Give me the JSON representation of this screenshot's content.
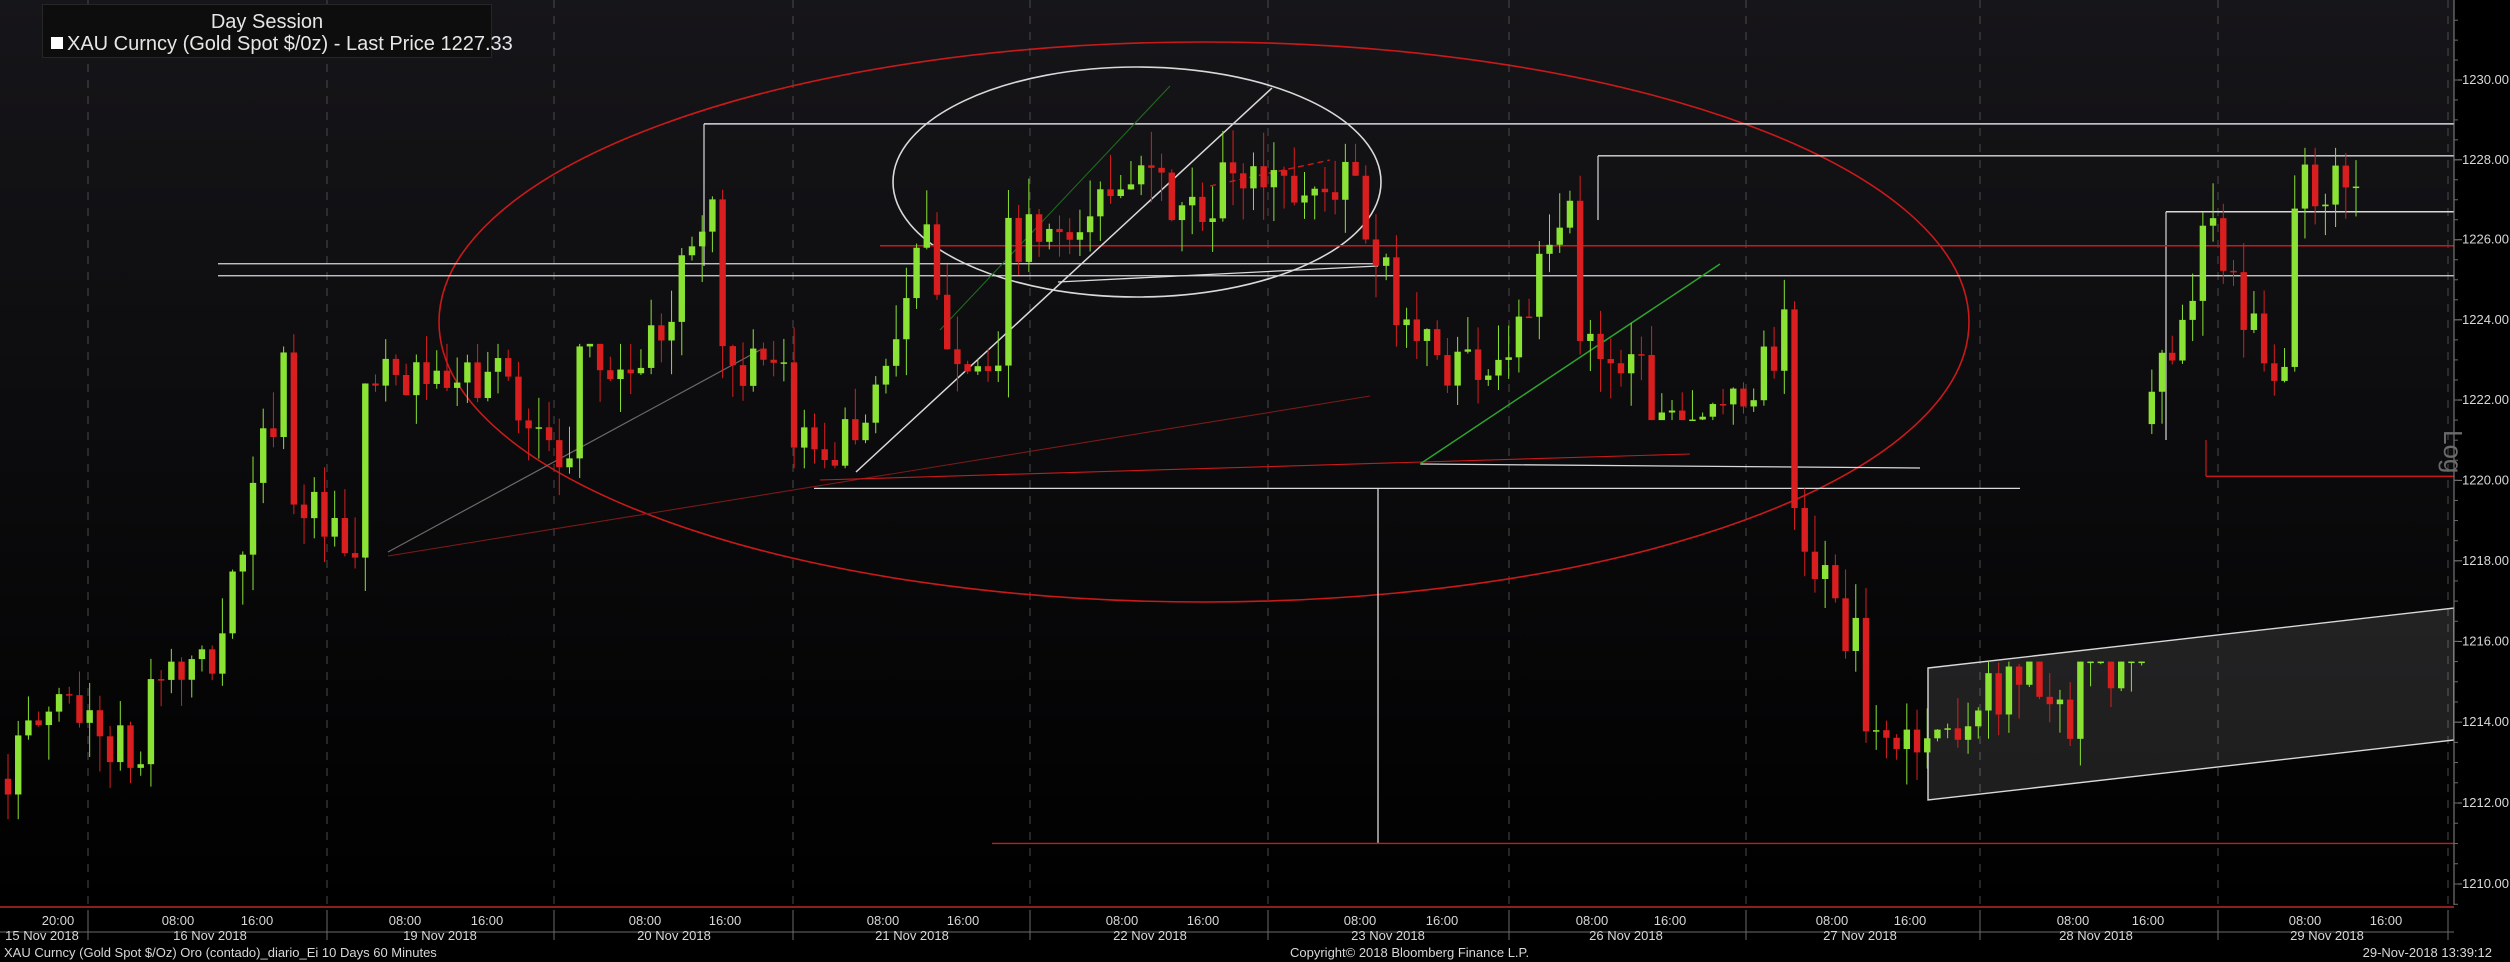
{
  "legend": {
    "title": "Day Session",
    "series_label": "XAU Curncy (Gold Spot $/0z) - Last Price 1227.33"
  },
  "footer": {
    "left": "XAU Curncy (Gold Spot  $/Oz) Oro (contado)_diario_Ei 10 Days 60 Minutes",
    "center": "Copyright© 2018 Bloomberg Finance L.P.",
    "right": "29-Nov-2018 13:39:12"
  },
  "scale_label": "Log",
  "colors": {
    "up": "#8ae234",
    "down": "#d81e1e",
    "background": "#000000",
    "grid": "#4a4a4a",
    "annotation_white": "#d9d9d9",
    "annotation_red": "#c81a1a",
    "annotation_green": "#2fa32f"
  },
  "chart_data": {
    "type": "candlestick",
    "title": "",
    "xlabel": "",
    "ylabel": "",
    "ylim": [
      1209.5,
      1231.6
    ],
    "y_ticks": [
      "1230.00",
      "1228.00",
      "1226.00",
      "1224.00",
      "1222.00",
      "1220.00",
      "1218.00",
      "1216.00",
      "1214.00",
      "1212.00",
      "1210.00"
    ],
    "scale": "log",
    "grid": true,
    "legend_position": "top-left",
    "x_time_labels": [
      "20:00",
      "08:00",
      "16:00",
      "08:00",
      "16:00",
      "08:00",
      "16:00",
      "08:00",
      "16:00",
      "08:00",
      "16:00",
      "08:00",
      "16:00",
      "08:00",
      "16:00",
      "08:00",
      "16:00",
      "08:00",
      "16:00",
      "08:00",
      "16:00"
    ],
    "x_date_labels": [
      "15 Nov 2018",
      "16 Nov 2018",
      "19 Nov 2018",
      "20 Nov 2018",
      "21 Nov 2018",
      "22 Nov 2018",
      "23 Nov 2018",
      "26 Nov 2018",
      "27 Nov 2018",
      "28 Nov 2018",
      "29 Nov 2018"
    ],
    "last_price": 1227.33,
    "key_price_levels": [
      1228.9,
      1228.1,
      1226.7,
      1225.85,
      1225.4,
      1225.1,
      1220.1,
      1219.8,
      1211.0
    ],
    "sessions": [
      {
        "date": "15 Nov 2018",
        "open": 1212.6,
        "high": 1215.9,
        "low": 1211.6,
        "close": 1215.2
      },
      {
        "date": "16 Nov 2018",
        "open": 1215.2,
        "high": 1225.3,
        "low": 1214.9,
        "close": 1222.4
      },
      {
        "date": "19 Nov 2018",
        "open": 1222.4,
        "high": 1223.4,
        "low": 1218.2,
        "close": 1222.8
      },
      {
        "date": "20 Nov 2018",
        "open": 1222.8,
        "high": 1228.8,
        "low": 1220.3,
        "close": 1221.0
      },
      {
        "date": "21 Nov 2018",
        "open": 1221.0,
        "high": 1227.7,
        "low": 1220.2,
        "close": 1226.0
      },
      {
        "date": "22 Nov 2018",
        "open": 1226.0,
        "high": 1229.3,
        "low": 1225.2,
        "close": 1227.6
      },
      {
        "date": "23 Nov 2018",
        "open": 1227.6,
        "high": 1228.4,
        "low": 1221.2,
        "close": 1223.0
      },
      {
        "date": "26 Nov 2018",
        "open": 1223.0,
        "high": 1228.0,
        "low": 1221.5,
        "close": 1221.9
      },
      {
        "date": "27 Nov 2018",
        "open": 1221.9,
        "high": 1225.4,
        "low": 1212.4,
        "close": 1213.6
      },
      {
        "date": "28 Nov 2018",
        "open": 1213.6,
        "high": 1215.5,
        "low": 1211.5,
        "close": 1221.4
      },
      {
        "date": "29 Nov 2018",
        "open": 1221.4,
        "high": 1228.3,
        "low": 1220.3,
        "close": 1227.33
      }
    ]
  }
}
